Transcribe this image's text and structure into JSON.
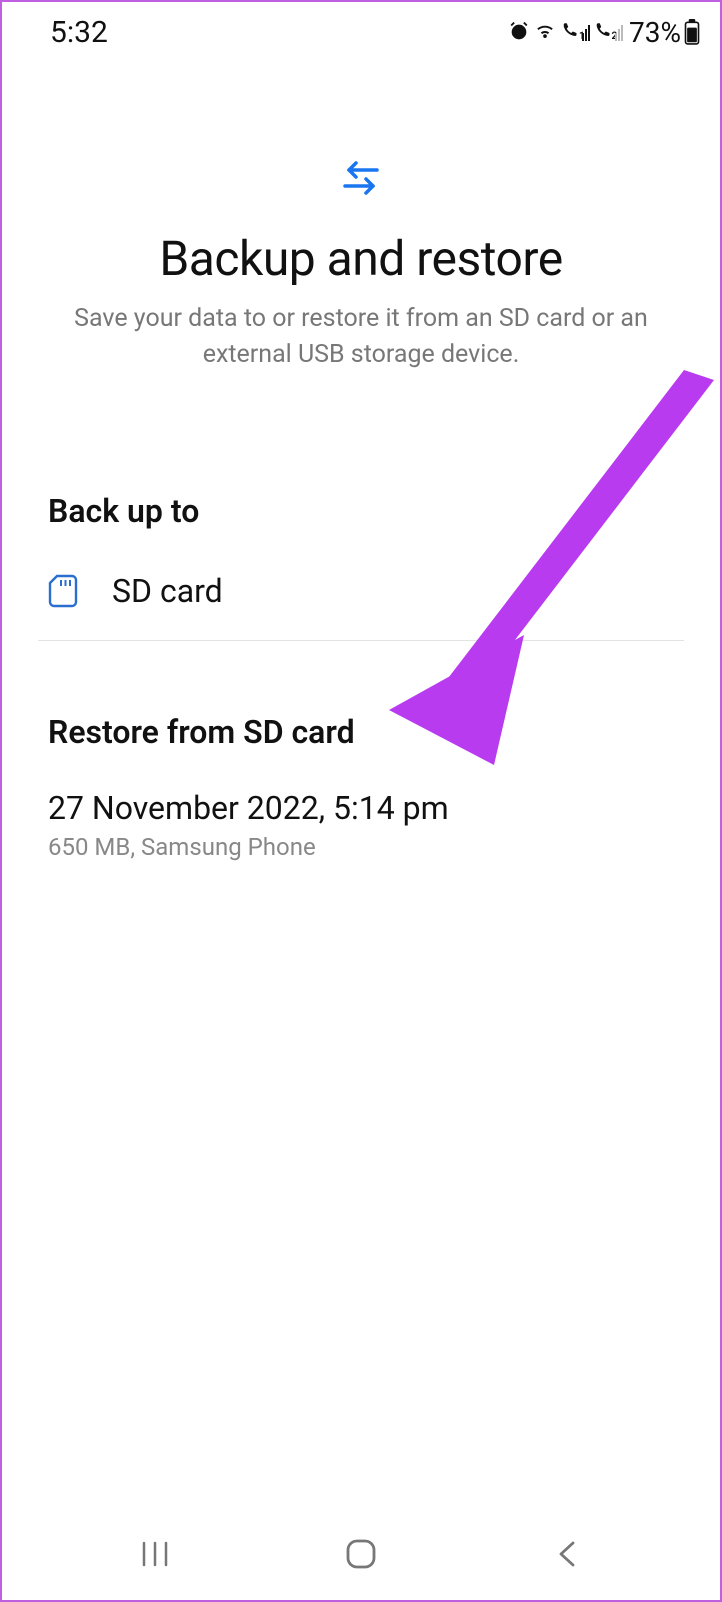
{
  "status": {
    "time": "5:32",
    "battery": "73%"
  },
  "header": {
    "title": "Backup and restore",
    "subtitle": "Save your data to or restore it from an SD card or an external USB storage device."
  },
  "backup": {
    "section_label": "Back up to",
    "target_label": "SD card"
  },
  "restore": {
    "section_label": "Restore from SD card",
    "item_title": "27 November 2022, 5:14 pm",
    "item_sub": "650 MB, Samsung Phone"
  },
  "colors": {
    "accent_blue": "#1976f0",
    "arrow": "#b83bf0"
  }
}
